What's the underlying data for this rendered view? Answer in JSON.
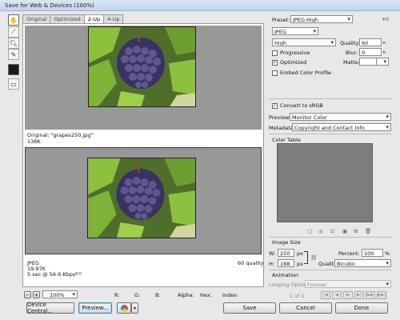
{
  "window": {
    "title": "Save for Web & Devices (100%)"
  },
  "tabs": [
    "Original",
    "Optimized",
    "2-Up",
    "4-Up"
  ],
  "original_info": {
    "filename": "Original: \"grapes250.jpg\"",
    "size": "138K"
  },
  "optimized_info": {
    "format": "JPEG",
    "size": "19.97K",
    "time": "5 sec @ 56.6 Kbps",
    "quality": "60 quality"
  },
  "status": {
    "zoom": "100%",
    "r": "R:",
    "g": "G:",
    "b": "B:",
    "alpha": "Alpha:",
    "hex": "Hex:",
    "index": "Index:"
  },
  "settings": {
    "preset_label": "Preset:",
    "preset_value": "JPEG High",
    "format": "JPEG",
    "quality_preset": "High",
    "quality_label": "Quality:",
    "quality_value": "60",
    "progressive": "Progressive",
    "blur_label": "Blur:",
    "blur_value": "0",
    "optimized": "Optimized",
    "matte_label": "Matte:",
    "embed_profile": "Embed Color Profile",
    "convert_srgb": "Convert to sRGB",
    "preview_label": "Preview:",
    "preview_value": "Monitor Color",
    "metadata_label": "Metadata:",
    "metadata_value": "Copyright and Contact Info"
  },
  "color_table": {
    "title": "Color Table"
  },
  "image_size": {
    "title": "Image Size",
    "w_label": "W:",
    "w_value": "250",
    "h_label": "H:",
    "h_value": "188",
    "unit": "px",
    "percent_label": "Percent:",
    "percent_value": "100",
    "percent_unit": "%",
    "quality_label": "Quality:",
    "quality_value": "Bicubic"
  },
  "animation": {
    "title": "Animation",
    "looping_label": "Looping Options:",
    "looping_value": "Forever",
    "frame": "1 of 1"
  },
  "buttons": {
    "device_central": "Device Central...",
    "preview": "Preview...",
    "save": "Save",
    "cancel": "Cancel",
    "done": "Done"
  }
}
